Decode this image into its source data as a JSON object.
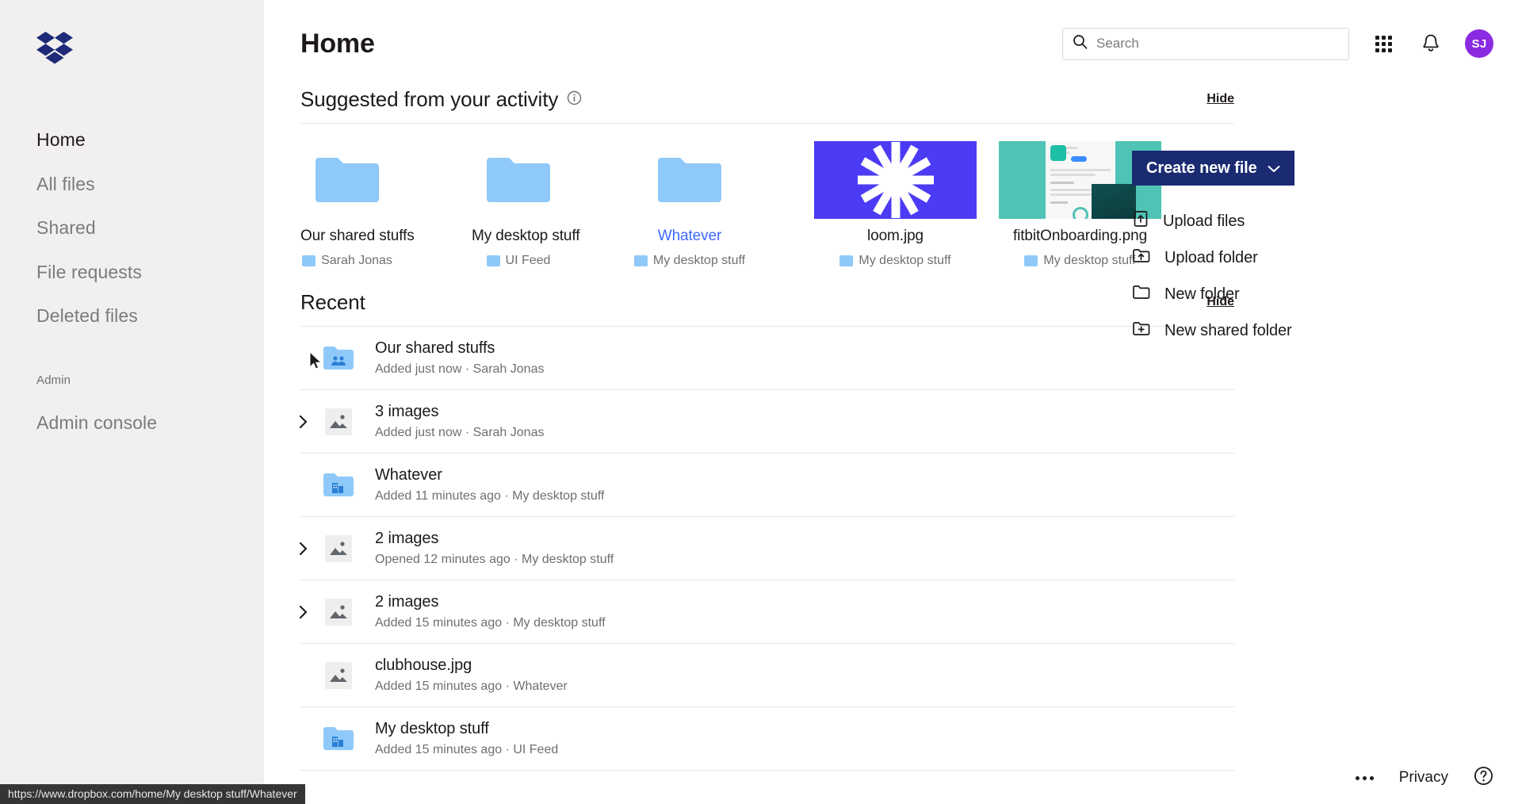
{
  "sidebar": {
    "logo_icon": "dropbox-logo",
    "items": [
      {
        "label": "Home",
        "active": true
      },
      {
        "label": "All files",
        "active": false
      },
      {
        "label": "Shared",
        "active": false
      },
      {
        "label": "File requests",
        "active": false
      },
      {
        "label": "Deleted files",
        "active": false
      }
    ],
    "section_label": "Admin",
    "admin_items": [
      {
        "label": "Admin console"
      }
    ]
  },
  "header": {
    "title": "Home",
    "search": {
      "placeholder": "Search",
      "value": "",
      "icon": "search-icon"
    },
    "apps_icon": "grid-apps-icon",
    "notifications_icon": "bell-icon",
    "avatar_initials": "SJ",
    "avatar_color": "#8a2be2"
  },
  "suggested": {
    "title": "Suggested from your activity",
    "info_icon": "info-icon",
    "hide_label": "Hide",
    "close_icon": "close-icon",
    "tiles": [
      {
        "name": "Our shared stuffs",
        "location": "Sarah Jonas",
        "kind": "folder",
        "highlight": false
      },
      {
        "name": "My desktop stuff",
        "location": "UI Feed",
        "kind": "folder",
        "highlight": false
      },
      {
        "name": "Whatever",
        "location": "My desktop stuff",
        "kind": "folder",
        "highlight": true
      },
      {
        "name": "loom.jpg",
        "location": "My desktop stuff",
        "kind": "image-loom",
        "highlight": false
      },
      {
        "name": "fitbitOnboarding.png",
        "location": "My desktop stuff",
        "kind": "image-fitbit",
        "highlight": false
      }
    ]
  },
  "recent": {
    "title": "Recent",
    "hide_label": "Hide",
    "rows": [
      {
        "title": "Our shared stuffs",
        "subtitle": "Added just now · Sarah Jonas",
        "icon": "shared-folder-icon",
        "expandable": false
      },
      {
        "title": "3 images",
        "subtitle": "Added just now · Sarah Jonas",
        "icon": "image-icon",
        "expandable": true
      },
      {
        "title": "Whatever",
        "subtitle": "Added 11 minutes ago · My desktop stuff",
        "icon": "team-folder-icon",
        "expandable": false
      },
      {
        "title": "2 images",
        "subtitle": "Opened 12 minutes ago · My desktop stuff",
        "icon": "image-icon",
        "expandable": true
      },
      {
        "title": "2 images",
        "subtitle": "Added 15 minutes ago · My desktop stuff",
        "icon": "image-icon",
        "expandable": true
      },
      {
        "title": "clubhouse.jpg",
        "subtitle": "Added 15 minutes ago · Whatever",
        "icon": "image-icon",
        "expandable": false
      },
      {
        "title": "My desktop stuff",
        "subtitle": "Added 15 minutes ago · UI Feed",
        "icon": "team-folder-icon",
        "expandable": false
      }
    ]
  },
  "rail": {
    "create_button": {
      "label": "Create new file",
      "chevron_icon": "chevron-down-icon",
      "color": "#1a2b72"
    },
    "actions": [
      {
        "label": "Upload files",
        "icon": "upload-file-icon"
      },
      {
        "label": "Upload folder",
        "icon": "upload-folder-icon"
      },
      {
        "label": "New folder",
        "icon": "folder-icon"
      },
      {
        "label": "New shared folder",
        "icon": "new-shared-folder-icon"
      }
    ]
  },
  "footer": {
    "more_icon": "more-horizontal-icon",
    "privacy_label": "Privacy",
    "help_icon": "help-icon"
  },
  "statusbar": {
    "url": "https://www.dropbox.com/home/My desktop stuff/Whatever"
  }
}
